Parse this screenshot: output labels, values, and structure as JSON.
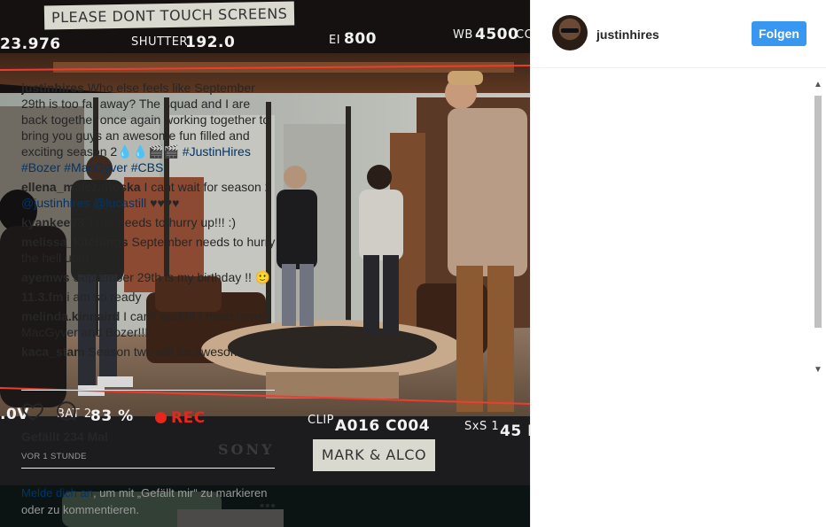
{
  "photo": {
    "sign_top": "PLEASE DONT TOUCH SCREENS",
    "sign_bottom": "MARK & ALCO",
    "brand": "SONY",
    "fps": "23.976",
    "shutter_label": "SHUTTER",
    "shutter_value": "192.0",
    "ei_label": "EI",
    "ei_value": "800",
    "wb_label": "WB",
    "wb_value": "4500",
    "wb_suffix": "CC",
    "voltage": ".0V",
    "bat_label": "BAT 2",
    "bat_value": "83 %",
    "rec": "REC",
    "clip_label": "CLIP",
    "clip_value": "A016 C004",
    "sxs_label": "SxS 1",
    "sxs_value": "45 M"
  },
  "post": {
    "username": "justinhires",
    "follow_label": "Folgen",
    "caption": {
      "user": "justinhires",
      "text": "Who else feels like September 29th is too far away? The squad and I are back together once again working together to bring you guys an awesome fun filled and exciting season 2💧💧🎬🎬",
      "tags": "#JustinHires #Bozer #MacGyver #CBS"
    },
    "comments": [
      {
        "user": "ellena_malezanoska",
        "text": "I cant wait for season 2",
        "mentions": "@justinhires @lucastill",
        "suffix": "♥♥♥♥"
      },
      {
        "user": "kyankee93",
        "text": "Time needs to hurry up!!! :)"
      },
      {
        "user": "melissa_kitchings",
        "text": "September needs to hurry the hell up!!!"
      },
      {
        "user": "ayemws",
        "text": "September 29th is my birthday !! 🙂"
      },
      {
        "user": "11.3.fm",
        "text": "i am so ready"
      },
      {
        "user": "melinda.kinnaird",
        "text": "I can't wait!!!! I need more MacGyver and Bozer!!!!"
      },
      {
        "user": "kaca_stam",
        "text": "Season two will be awesome"
      }
    ],
    "likes": "Gefällt 234 Mal",
    "time_ago": "VOR 1 STUNDE",
    "login_link": "Melde dich an",
    "login_text": ", um mit „Gefällt mir“ zu markieren oder zu kommentieren.",
    "more_label": "•••"
  },
  "icons": {
    "like": "heart-icon",
    "comment": "comment-icon",
    "more": "more-options-icon"
  },
  "colors": {
    "follow_button": "#3897f0",
    "link": "#003569",
    "rec": "#e8261c"
  }
}
